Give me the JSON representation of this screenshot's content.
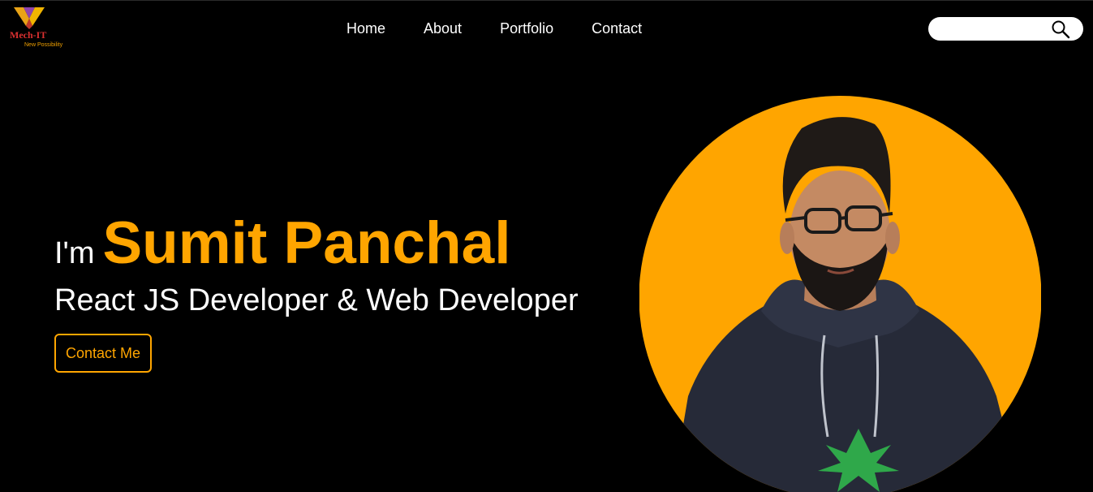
{
  "header": {
    "logo": {
      "name": "Mech-IT",
      "tagline": "New Possibility"
    },
    "nav": [
      "Home",
      "About",
      "Portfolio",
      "Contact"
    ],
    "search": {
      "placeholder": "",
      "value": "",
      "icon": "search-icon"
    }
  },
  "hero": {
    "prefix": "I'm",
    "name": "Sumit Panchal",
    "role": "React JS Developer & Web Developer",
    "cta_label": "Contact Me"
  },
  "colors": {
    "background": "#000000",
    "accent": "#ffa500",
    "text": "#ffffff",
    "search_bg": "#ffffff"
  }
}
